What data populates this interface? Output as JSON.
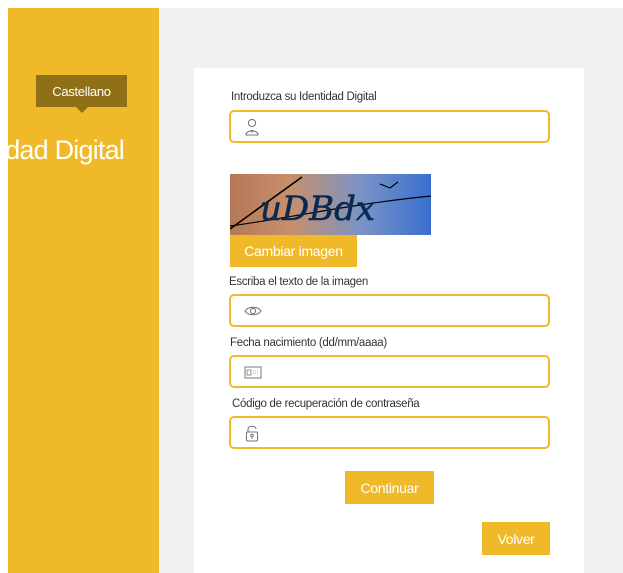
{
  "sidebar": {
    "language": "Castellano",
    "title": "dad Digital"
  },
  "form": {
    "identity": {
      "label": "Introduzca su Identidad Digital",
      "value": "",
      "icon": "user-icon"
    },
    "captcha": {
      "text": "uDBdx",
      "change_button": "Cambiar imagen"
    },
    "captcha_text": {
      "label": "Escriba el texto de la imagen",
      "value": "",
      "icon": "eye-icon"
    },
    "birthdate": {
      "label": "Fecha nacimiento (dd/mm/aaaa)",
      "value": "",
      "icon": "id-card-icon"
    },
    "recovery_code": {
      "label": "Código de recuperación de contraseña",
      "value": "",
      "icon": "unlock-icon"
    },
    "continue_button": "Continuar",
    "back_button": "Volver"
  },
  "colors": {
    "accent": "#f0b92a",
    "language_badge": "#8f6f18",
    "background": "#f1f1f1"
  }
}
